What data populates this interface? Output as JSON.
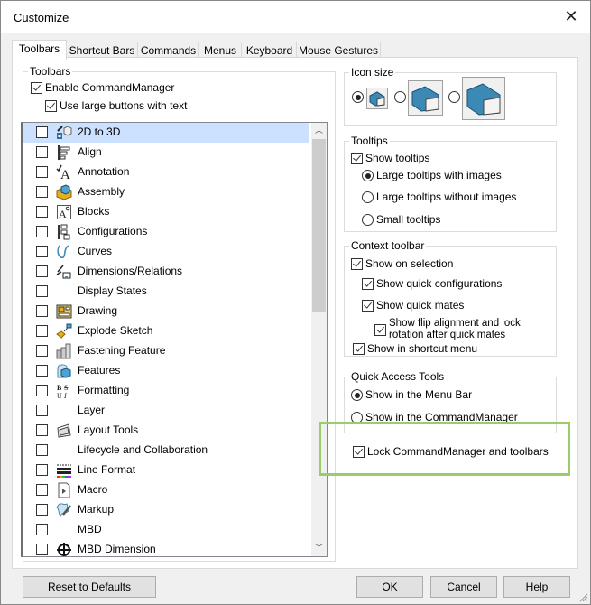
{
  "window": {
    "title": "Customize",
    "close_icon": "close-icon"
  },
  "tabs": [
    {
      "label": "Toolbars",
      "active": true
    },
    {
      "label": "Shortcut Bars",
      "active": false
    },
    {
      "label": "Commands",
      "active": false
    },
    {
      "label": "Menus",
      "active": false
    },
    {
      "label": "Keyboard",
      "active": false
    },
    {
      "label": "Mouse Gestures",
      "active": false
    }
  ],
  "toolbars_group": {
    "legend": "Toolbars",
    "enable_commandmanager": {
      "label": "Enable CommandManager",
      "checked": true
    },
    "use_large_buttons": {
      "label": "Use large buttons with text",
      "checked": true
    },
    "items": [
      {
        "label": "2D to 3D",
        "icon": "2d-to-3d-icon",
        "checked": false,
        "selected": true
      },
      {
        "label": "Align",
        "icon": "align-icon",
        "checked": false
      },
      {
        "label": "Annotation",
        "icon": "annotation-icon",
        "checked": false
      },
      {
        "label": "Assembly",
        "icon": "assembly-icon",
        "checked": false
      },
      {
        "label": "Blocks",
        "icon": "blocks-icon",
        "checked": false
      },
      {
        "label": "Configurations",
        "icon": "configurations-icon",
        "checked": false
      },
      {
        "label": "Curves",
        "icon": "curves-icon",
        "checked": false
      },
      {
        "label": "Dimensions/Relations",
        "icon": "dimensions-relations-icon",
        "checked": false
      },
      {
        "label": "Display States",
        "icon": "",
        "checked": false
      },
      {
        "label": "Drawing",
        "icon": "drawing-icon",
        "checked": false
      },
      {
        "label": "Explode Sketch",
        "icon": "explode-sketch-icon",
        "checked": false
      },
      {
        "label": "Fastening Feature",
        "icon": "fastening-feature-icon",
        "checked": false
      },
      {
        "label": "Features",
        "icon": "features-icon",
        "checked": false
      },
      {
        "label": "Formatting",
        "icon": "formatting-icon",
        "checked": false
      },
      {
        "label": "Layer",
        "icon": "",
        "checked": false
      },
      {
        "label": "Layout Tools",
        "icon": "layout-tools-icon",
        "checked": false
      },
      {
        "label": "Lifecycle and Collaboration",
        "icon": "",
        "checked": false
      },
      {
        "label": "Line Format",
        "icon": "line-format-icon",
        "checked": false
      },
      {
        "label": "Macro",
        "icon": "macro-icon",
        "checked": false
      },
      {
        "label": "Markup",
        "icon": "markup-icon",
        "checked": false
      },
      {
        "label": "MBD",
        "icon": "",
        "checked": false
      },
      {
        "label": "MBD Dimension",
        "icon": "mbd-dimension-icon",
        "checked": false
      }
    ]
  },
  "icon_size": {
    "legend": "Icon size",
    "options": [
      {
        "size": "small",
        "selected": true
      },
      {
        "size": "medium",
        "selected": false
      },
      {
        "size": "large",
        "selected": false
      }
    ]
  },
  "tooltips": {
    "legend": "Tooltips",
    "show_tooltips": {
      "label": "Show tooltips",
      "checked": true
    },
    "options": [
      {
        "label": "Large tooltips with images",
        "selected": true
      },
      {
        "label": "Large tooltips without images",
        "selected": false
      },
      {
        "label": "Small tooltips",
        "selected": false
      }
    ]
  },
  "context_toolbar": {
    "legend": "Context toolbar",
    "show_on_selection": {
      "label": "Show on selection",
      "checked": true
    },
    "show_quick_configurations": {
      "label": "Show quick configurations",
      "checked": true
    },
    "show_quick_mates": {
      "label": "Show quick mates",
      "checked": true
    },
    "show_flip_alignment": {
      "label_line1": "Show flip alignment and lock",
      "label_line2": "rotation after quick mates",
      "checked": true
    },
    "show_in_shortcut_menu": {
      "label": "Show in shortcut menu",
      "checked": true
    }
  },
  "quick_access_tools": {
    "legend": "Quick Access Tools",
    "options": [
      {
        "label": "Show in the Menu Bar",
        "selected": true
      },
      {
        "label": "Show in the CommandManager",
        "selected": false
      }
    ]
  },
  "lock_commandmanager": {
    "label": "Lock CommandManager and toolbars",
    "checked": true
  },
  "highlight_color": "#9ccb6a",
  "footer": {
    "reset_label": "Reset to Defaults",
    "ok_label": "OK",
    "cancel_label": "Cancel",
    "help_label": "Help"
  }
}
